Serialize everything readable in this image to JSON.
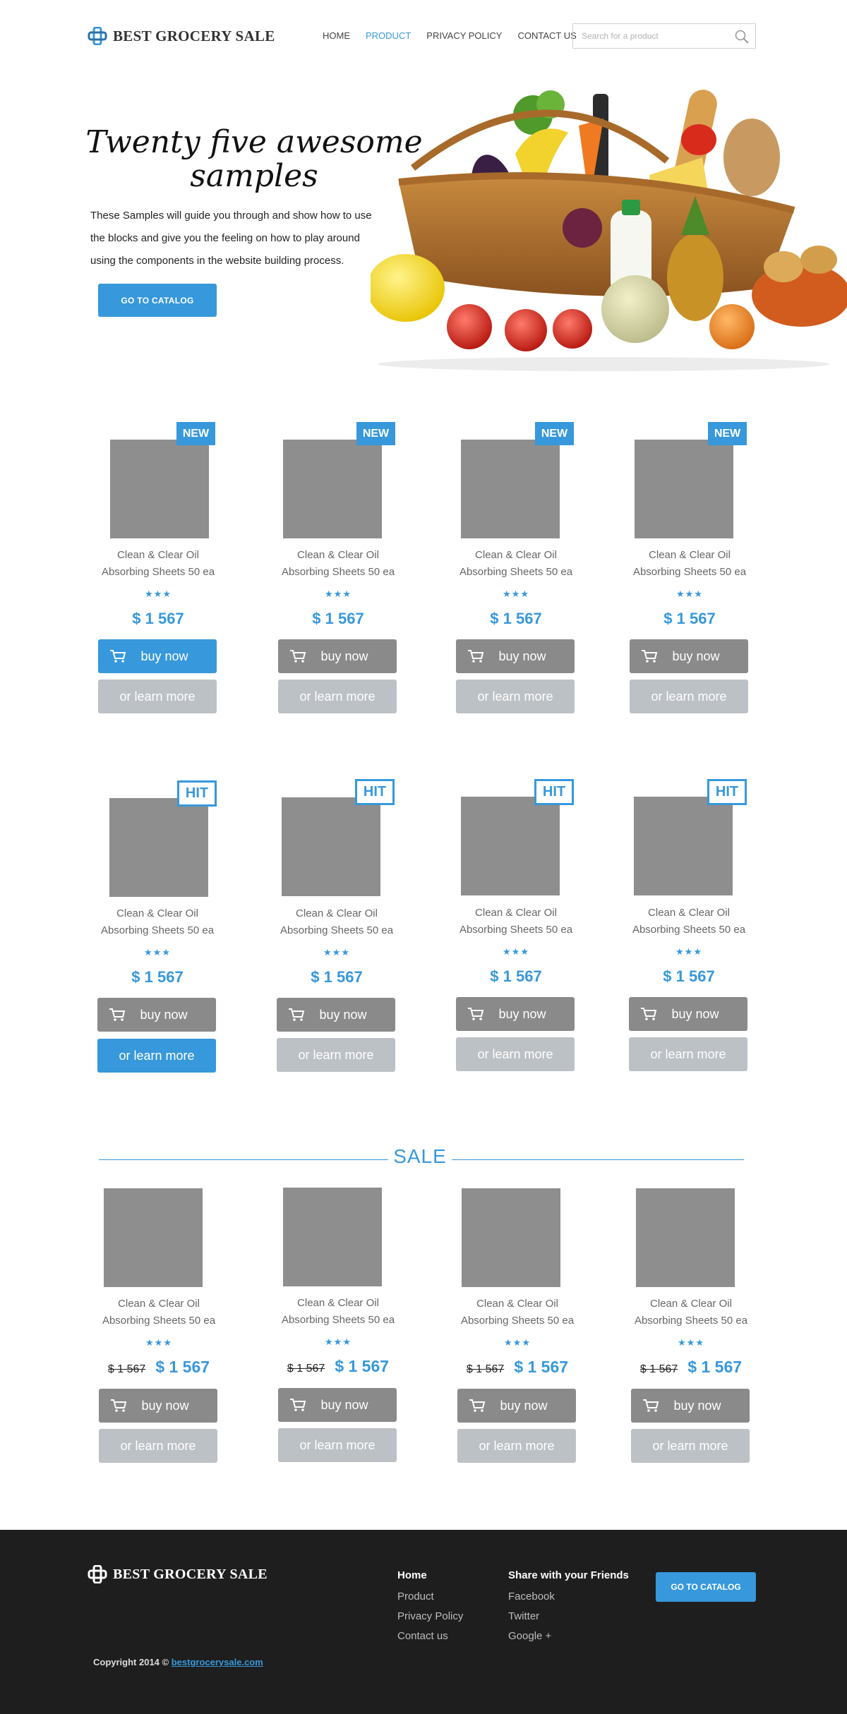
{
  "header": {
    "brand": "BEST GROCERY SALE",
    "nav": [
      {
        "label": "HOME",
        "active": false
      },
      {
        "label": "PRODUCT",
        "active": true
      },
      {
        "label": "PRIVACY POLICY",
        "active": false
      },
      {
        "label": "CONTACT US",
        "active": false
      }
    ],
    "search_placeholder": "Search for a product"
  },
  "hero": {
    "title": "Twenty five awesome samples",
    "text": "These Samples will guide you through and show how to use the blocks and give you the feeling on how to play around using the components in the website building process.",
    "button": "GO TO CATALOG"
  },
  "product": {
    "name": "Clean & Clear Oil Absorbing Sheets 50 ea",
    "stars": "★★★",
    "price": "$ 1 567",
    "old_price": "$ 1 567",
    "buy_label": "buy now",
    "more_label": "or learn more"
  },
  "badges": {
    "new": "NEW",
    "hit": "HIT"
  },
  "sale": {
    "title": "SALE"
  },
  "footer": {
    "brand": "BEST GROCERY SALE",
    "nav_head": "Home",
    "nav_links": [
      "Product",
      "Privacy Policy",
      "Contact us"
    ],
    "share_head": "Share with your Friends",
    "share_links": [
      "Facebook",
      "Twitter",
      "Google +"
    ],
    "button": "GO TO CATALOG",
    "copyright_prefix": "Copyright 2014 ©",
    "copyright_link": "bestgrocerysale.com"
  },
  "colors": {
    "accent": "#3798db",
    "thumb": "#8e8e8e",
    "button_gray": "#8a8a8a",
    "button_light": "#bcc1c6",
    "footer_bg": "#1e1e1e"
  }
}
